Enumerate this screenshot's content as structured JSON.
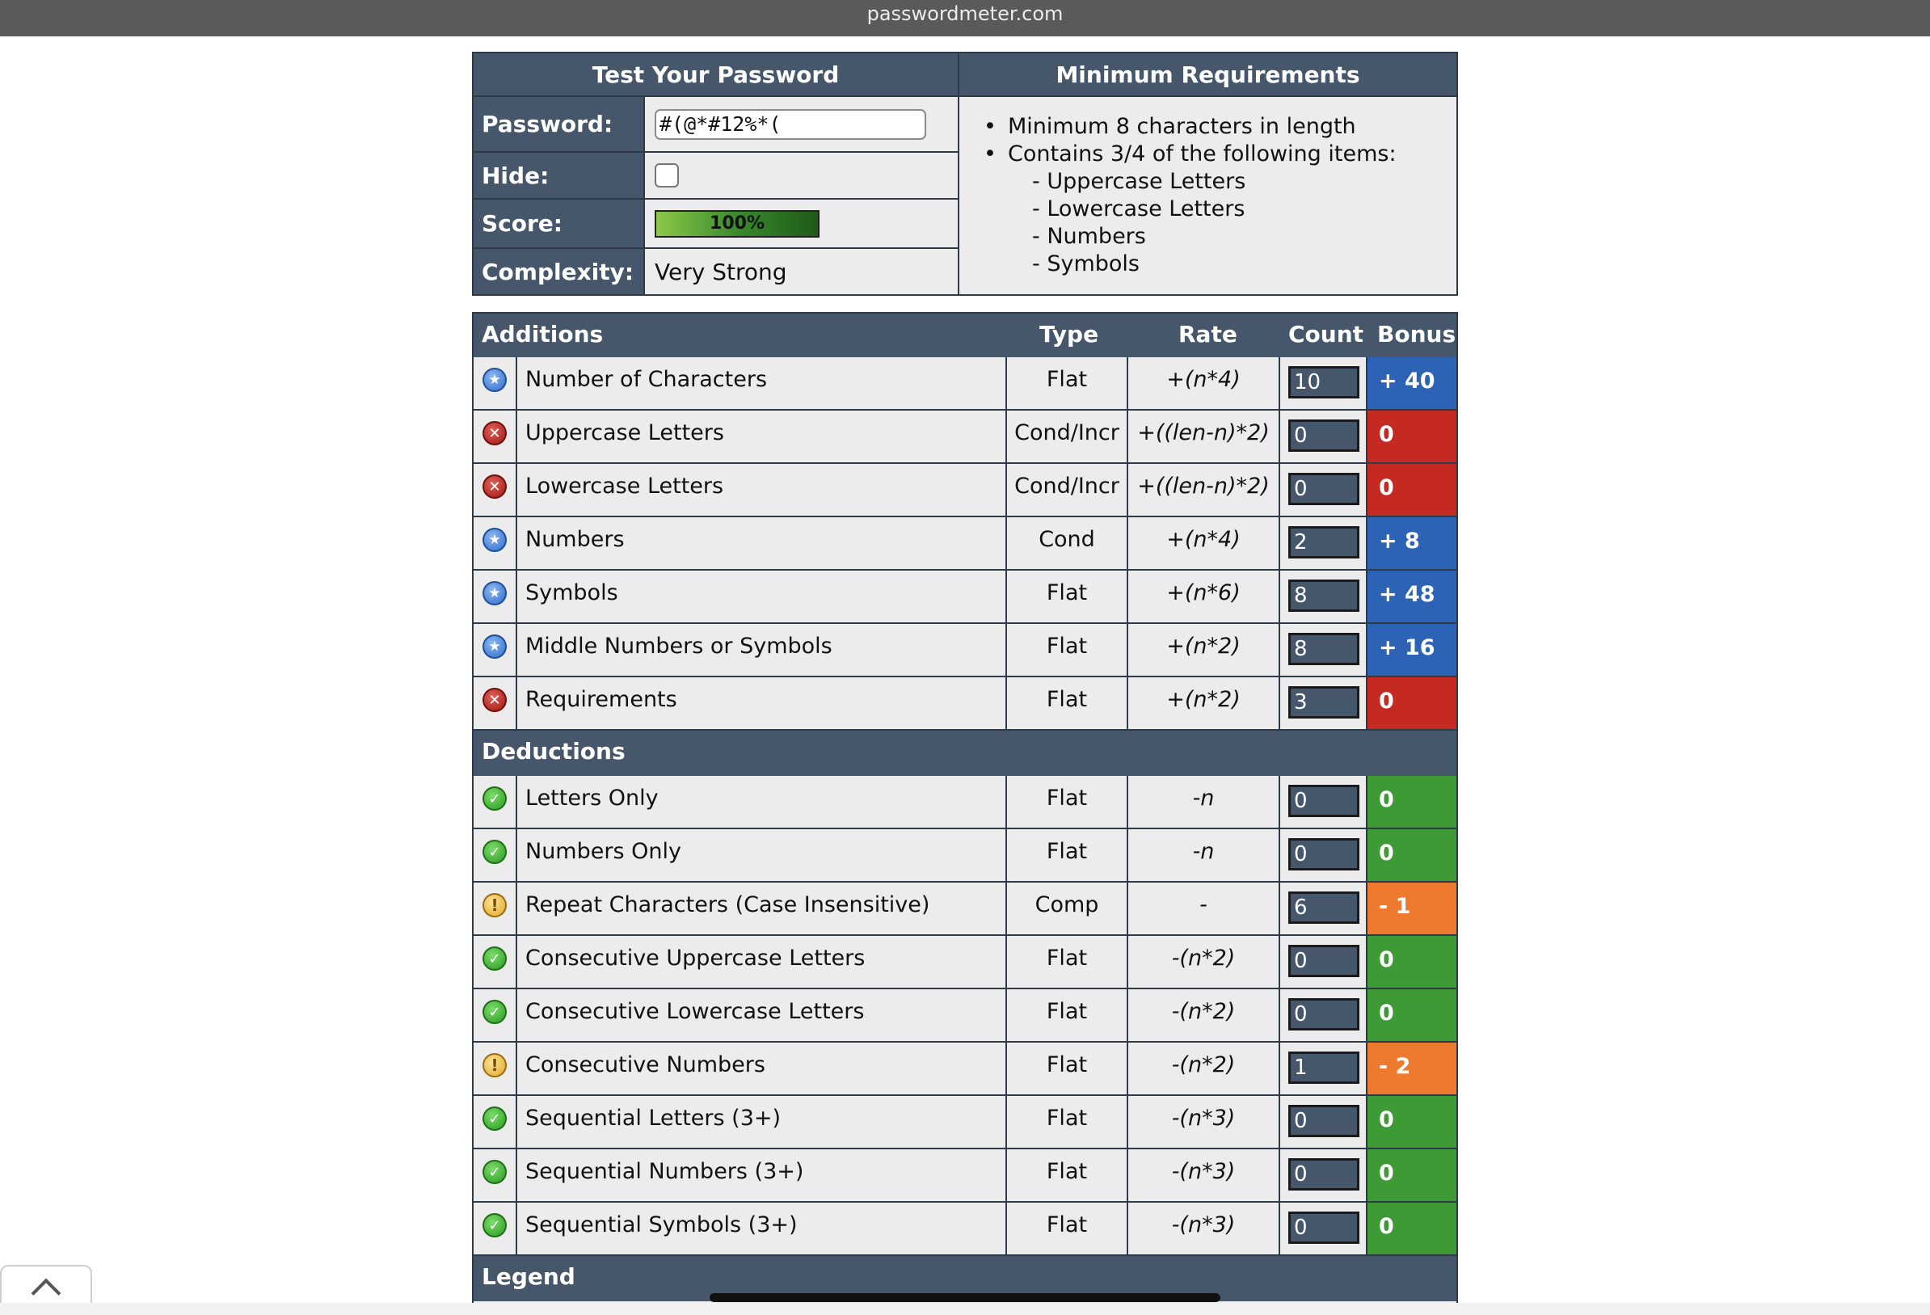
{
  "browser": {
    "url": "passwordmeter.com"
  },
  "test": {
    "title": "Test Your Password",
    "password_label": "Password:",
    "password_value": "#(@*#12%*(",
    "hide_label": "Hide:",
    "score_label": "Score:",
    "score_value": "100%",
    "score_fraction": 1.0,
    "complexity_label": "Complexity:",
    "complexity_value": "Very Strong"
  },
  "requirements": {
    "title": "Minimum Requirements",
    "items": [
      "Minimum 8 characters in length",
      "Contains 3/4 of the following items:"
    ],
    "subitems": [
      "- Uppercase Letters",
      "- Lowercase Letters",
      "- Numbers",
      "- Symbols"
    ]
  },
  "table": {
    "headers": {
      "additions": "Additions",
      "type": "Type",
      "rate": "Rate",
      "count": "Count",
      "bonus": "Bonus"
    },
    "deductions_label": "Deductions",
    "legend_label": "Legend",
    "additions": [
      {
        "status": "star",
        "name": "Number of Characters",
        "type": "Flat",
        "rate": "+(n*4)",
        "count": "10",
        "bonus": "+ 40",
        "color": "#2c63b5"
      },
      {
        "status": "x",
        "name": "Uppercase Letters",
        "type": "Cond/Incr",
        "rate": "+((len-n)*2)",
        "count": "0",
        "bonus": "0",
        "color": "#c52a22"
      },
      {
        "status": "x",
        "name": "Lowercase Letters",
        "type": "Cond/Incr",
        "rate": "+((len-n)*2)",
        "count": "0",
        "bonus": "0",
        "color": "#c52a22"
      },
      {
        "status": "star",
        "name": "Numbers",
        "type": "Cond",
        "rate": "+(n*4)",
        "count": "2",
        "bonus": "+ 8",
        "color": "#2c63b5"
      },
      {
        "status": "star",
        "name": "Symbols",
        "type": "Flat",
        "rate": "+(n*6)",
        "count": "8",
        "bonus": "+ 48",
        "color": "#2c63b5"
      },
      {
        "status": "star",
        "name": "Middle Numbers or Symbols",
        "type": "Flat",
        "rate": "+(n*2)",
        "count": "8",
        "bonus": "+ 16",
        "color": "#2c63b5"
      },
      {
        "status": "x",
        "name": "Requirements",
        "type": "Flat",
        "rate": "+(n*2)",
        "count": "3",
        "bonus": "0",
        "color": "#c52a22"
      }
    ],
    "deductions": [
      {
        "status": "check",
        "name": "Letters Only",
        "type": "Flat",
        "rate": "-n",
        "count": "0",
        "bonus": "0",
        "color": "#3e9a35"
      },
      {
        "status": "check",
        "name": "Numbers Only",
        "type": "Flat",
        "rate": "-n",
        "count": "0",
        "bonus": "0",
        "color": "#3e9a35"
      },
      {
        "status": "warn",
        "name": "Repeat Characters (Case Insensitive)",
        "type": "Comp",
        "rate": "-",
        "count": "6",
        "bonus": "- 1",
        "color": "#ee7a30"
      },
      {
        "status": "check",
        "name": "Consecutive Uppercase Letters",
        "type": "Flat",
        "rate": "-(n*2)",
        "count": "0",
        "bonus": "0",
        "color": "#3e9a35"
      },
      {
        "status": "check",
        "name": "Consecutive Lowercase Letters",
        "type": "Flat",
        "rate": "-(n*2)",
        "count": "0",
        "bonus": "0",
        "color": "#3e9a35"
      },
      {
        "status": "warn",
        "name": "Consecutive Numbers",
        "type": "Flat",
        "rate": "-(n*2)",
        "count": "1",
        "bonus": "- 2",
        "color": "#ee7a30"
      },
      {
        "status": "check",
        "name": "Sequential Letters (3+)",
        "type": "Flat",
        "rate": "-(n*3)",
        "count": "0",
        "bonus": "0",
        "color": "#3e9a35"
      },
      {
        "status": "check",
        "name": "Sequential Numbers (3+)",
        "type": "Flat",
        "rate": "-(n*3)",
        "count": "0",
        "bonus": "0",
        "color": "#3e9a35"
      },
      {
        "status": "check",
        "name": "Sequential Symbols (3+)",
        "type": "Flat",
        "rate": "-(n*3)",
        "count": "0",
        "bonus": "0",
        "color": "#3e9a35"
      }
    ]
  },
  "icons": {
    "star": "star-badge-icon",
    "x": "error-x-icon",
    "check": "success-check-icon",
    "warn": "warning-exclamation-icon",
    "scroll_top": "chevron-up-icon"
  }
}
